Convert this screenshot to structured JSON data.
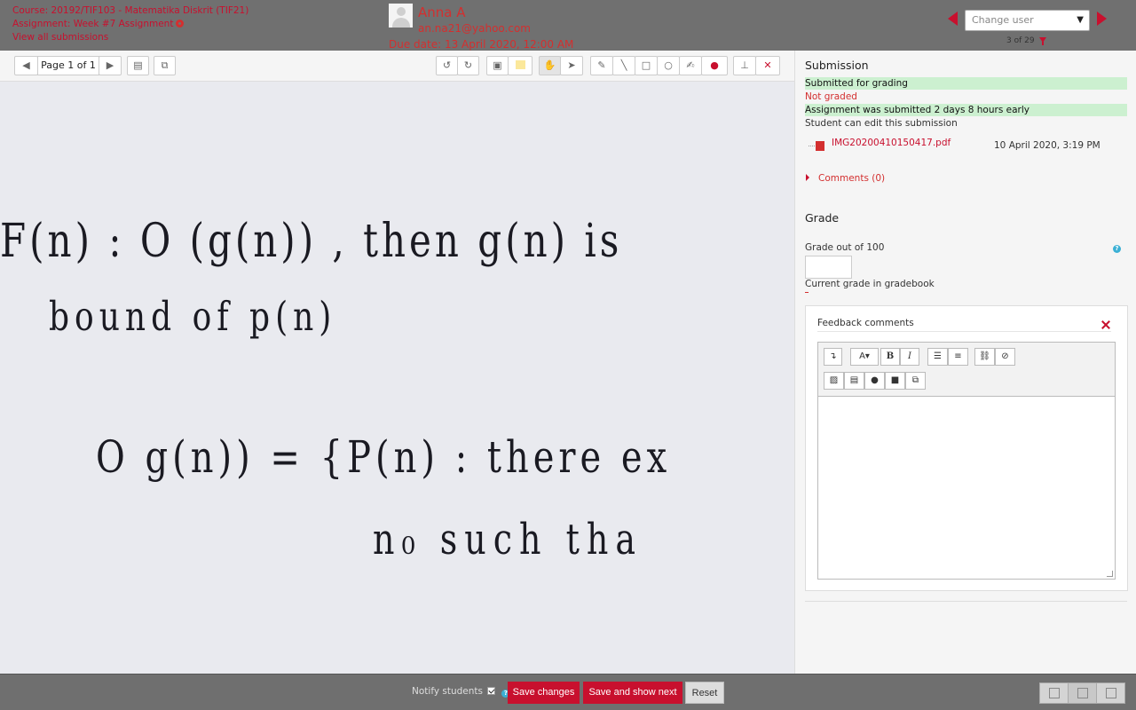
{
  "header": {
    "course": "Course: 20192/TIF103 - Matematika Diskrit (TIF21)",
    "assignment": "Assignment: Week #7 Assignment",
    "view_all": "View all submissions",
    "user_name": "Anna A",
    "user_email": "an.na21@yahoo.com",
    "due_date": "Due date: 13 April 2020, 12:00 AM",
    "change_user_placeholder": "Change user",
    "user_count": "3 of 29"
  },
  "toolbar": {
    "page_label": "Page 1 of 1",
    "icons": [
      "prev-page",
      "next-page",
      "search-comments",
      "expand",
      "rotate-left",
      "rotate-right",
      "comment",
      "highlight-color",
      "pan",
      "select",
      "pen",
      "line",
      "rectangle",
      "oval",
      "highlight",
      "color-red",
      "stamp",
      "clear"
    ]
  },
  "document": {
    "lines": [
      "F(n) : O (g(n)) , then g(n) is",
      "bound of p(n)",
      "O g(n)) = {P(n) : there ex",
      "n₀ such tha"
    ]
  },
  "submission": {
    "title": "Submission",
    "status": "Submitted for grading",
    "grading_status": "Not graded",
    "timing": "Assignment was submitted 2 days 8 hours early",
    "edit": "Student can edit this submission",
    "file_name": "IMG20200410150417.pdf",
    "file_time": "10 April 2020, 3:19 PM",
    "comments": "Comments (0)"
  },
  "grade": {
    "title": "Grade",
    "grade_label": "Grade out of 100",
    "grade_value": "",
    "current_label": "Current grade in gradebook",
    "current_value": "-"
  },
  "feedback": {
    "title": "Feedback comments",
    "editor_text": ""
  },
  "footer": {
    "notify": "Notify students",
    "save": "Save changes",
    "save_next": "Save and show next",
    "reset": "Reset"
  },
  "colors": {
    "accent": "#c8102e",
    "header_bg": "#707070",
    "success_bg": "#ccf0d0"
  }
}
